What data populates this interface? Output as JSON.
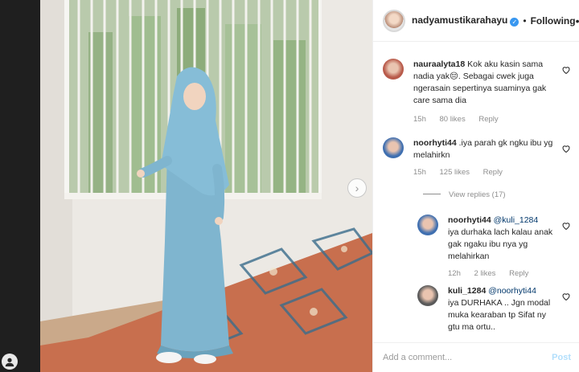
{
  "header": {
    "username": "nadyamustikarahayu",
    "follow_state": "Following",
    "separator": "•"
  },
  "comments": [
    {
      "username": "nauraalyta18",
      "text": "Kok aku kasin sama nadia yak😔. Sebagai cwek juga ngerasain sepertinya suaminya gak care sama dia",
      "time": "15h",
      "likes": "80 likes",
      "reply_label": "Reply",
      "avatar_color": "#b85a4a"
    },
    {
      "username": "noorhyti44",
      "text": ".iya parah gk ngku ibu yg melahirkn",
      "time": "15h",
      "likes": "125 likes",
      "reply_label": "Reply",
      "avatar_color": "#3f6fb0",
      "view_replies": "View replies (17)"
    }
  ],
  "replies": [
    {
      "username": "noorhyti44",
      "mention": "@kuli_1284",
      "text": "iya durhaka lach kalau anak gak ngaku ibu nya yg melahirkan",
      "time": "12h",
      "likes": "2 likes",
      "reply_label": "Reply",
      "avatar_color": "#3f6fb0"
    },
    {
      "username": "kuli_1284",
      "mention": "@noorhyti44",
      "text": "iya DURHAKA .. Jgn modal muka kearaban tp Sifat ny gtu ma ortu..",
      "avatar_color": "#5a5a5a"
    }
  ],
  "add_comment": {
    "placeholder": "Add a comment...",
    "post_label": "Post"
  },
  "icons": {
    "more": "more-options-icon",
    "verified": "verified-badge-icon",
    "heart": "heart-icon",
    "next": "chevron-right-icon",
    "profile": "profile-icon"
  },
  "colors": {
    "verified_blue": "#3897f0",
    "post_disabled": "#b2dffc",
    "mention": "#00376b",
    "meta_gray": "#8e8e8e"
  }
}
